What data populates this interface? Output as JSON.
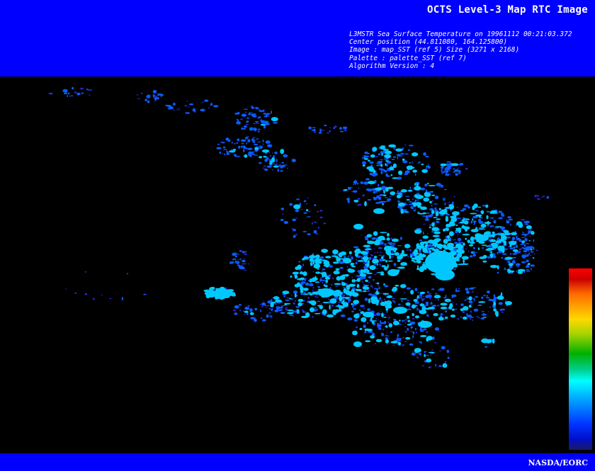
{
  "header": {
    "title": "OCTS Level-3 Map RTC Image",
    "metadata_lines": [
      "L3MSTR Sea Surface Temperature on 19961112 00:21:03.372",
      "Center position (44.811080, 164.125800)",
      "Image : map_SST (ref 5) Size (3271 x 2168)",
      "Palette : palette_SST (ref 7)",
      "Algorithm Version : 4"
    ]
  },
  "footer": {
    "credit": "NASDA/EORC"
  },
  "colors": {
    "banner_blue": "#0000ff",
    "background": "#000000",
    "sst_cyan": "#00c8ff",
    "sst_blue": "#0055ff",
    "sst_deep": "#2222cc"
  }
}
